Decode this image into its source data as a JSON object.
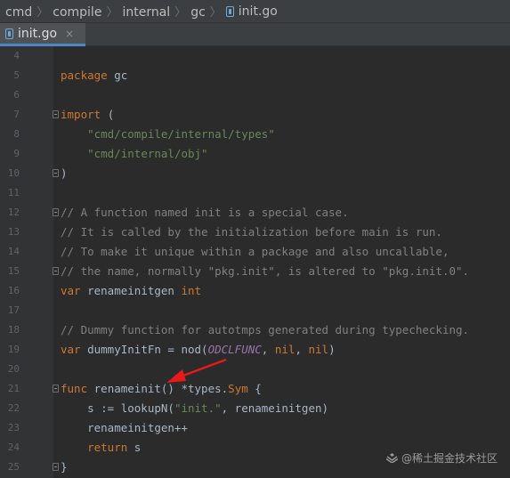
{
  "breadcrumb": {
    "items": [
      "cmd",
      "compile",
      "internal",
      "gc"
    ],
    "file": "init.go"
  },
  "tabs": [
    {
      "label": "init.go",
      "close": "×"
    }
  ],
  "editor": {
    "lines": [
      {
        "num": "4",
        "tokens": []
      },
      {
        "num": "5",
        "tokens": [
          {
            "t": "package ",
            "c": "kw"
          },
          {
            "t": "gc",
            "c": ""
          }
        ]
      },
      {
        "num": "6",
        "tokens": []
      },
      {
        "num": "7",
        "fold": true,
        "tokens": [
          {
            "t": "import ",
            "c": "kw"
          },
          {
            "t": "(",
            "c": ""
          }
        ]
      },
      {
        "num": "8",
        "tokens": [
          {
            "t": "    ",
            "c": ""
          },
          {
            "t": "\"cmd/compile/internal/types\"",
            "c": "str"
          }
        ]
      },
      {
        "num": "9",
        "tokens": [
          {
            "t": "    ",
            "c": ""
          },
          {
            "t": "\"cmd/internal/obj\"",
            "c": "str"
          }
        ]
      },
      {
        "num": "10",
        "fold": true,
        "tokens": [
          {
            "t": ")",
            "c": ""
          }
        ]
      },
      {
        "num": "11",
        "tokens": []
      },
      {
        "num": "12",
        "fold": true,
        "tokens": [
          {
            "t": "// A function named init is a special case.",
            "c": "cm"
          }
        ]
      },
      {
        "num": "13",
        "tokens": [
          {
            "t": "// It is called by the initialization before main is run.",
            "c": "cm"
          }
        ]
      },
      {
        "num": "14",
        "tokens": [
          {
            "t": "// To make it unique within a package and also uncallable,",
            "c": "cm"
          }
        ]
      },
      {
        "num": "15",
        "fold": true,
        "tokens": [
          {
            "t": "// the name, normally \"pkg.init\", is altered to \"pkg.init.0\".",
            "c": "cm"
          }
        ]
      },
      {
        "num": "16",
        "tokens": [
          {
            "t": "var ",
            "c": "kw"
          },
          {
            "t": "renameinitgen ",
            "c": ""
          },
          {
            "t": "int",
            "c": "ty"
          }
        ]
      },
      {
        "num": "17",
        "tokens": []
      },
      {
        "num": "18",
        "tokens": [
          {
            "t": "// Dummy function for autotmps generated during typechecking.",
            "c": "cm"
          }
        ]
      },
      {
        "num": "19",
        "tokens": [
          {
            "t": "var ",
            "c": "kw"
          },
          {
            "t": "dummyInitFn = nod(",
            "c": ""
          },
          {
            "t": "ODCLFUNC",
            "c": "const"
          },
          {
            "t": ", ",
            "c": ""
          },
          {
            "t": "nil",
            "c": "kw"
          },
          {
            "t": ", ",
            "c": ""
          },
          {
            "t": "nil",
            "c": "kw"
          },
          {
            "t": ")",
            "c": ""
          }
        ]
      },
      {
        "num": "20",
        "tokens": []
      },
      {
        "num": "21",
        "fold": true,
        "tokens": [
          {
            "t": "func ",
            "c": "kw"
          },
          {
            "t": "renameinit",
            "c": ""
          },
          {
            "t": "() *types.",
            "c": ""
          },
          {
            "t": "Sym",
            "c": "ty"
          },
          {
            "t": " {",
            "c": ""
          }
        ]
      },
      {
        "num": "22",
        "tokens": [
          {
            "t": "    s := lookupN(",
            "c": ""
          },
          {
            "t": "\"init.\"",
            "c": "str"
          },
          {
            "t": ", renameinitgen)",
            "c": ""
          }
        ]
      },
      {
        "num": "23",
        "tokens": [
          {
            "t": "    renameinitgen++",
            "c": ""
          }
        ]
      },
      {
        "num": "24",
        "tokens": [
          {
            "t": "    ",
            "c": ""
          },
          {
            "t": "return ",
            "c": "kw"
          },
          {
            "t": "s",
            "c": ""
          }
        ]
      },
      {
        "num": "25",
        "fold": true,
        "tokens": [
          {
            "t": "}",
            "c": ""
          }
        ]
      }
    ]
  },
  "watermark": "@稀土掘金技术社区",
  "colors": {
    "arrow": "#e8191a",
    "keyword": "#cc7832",
    "string": "#6a8759",
    "comment": "#808080"
  }
}
